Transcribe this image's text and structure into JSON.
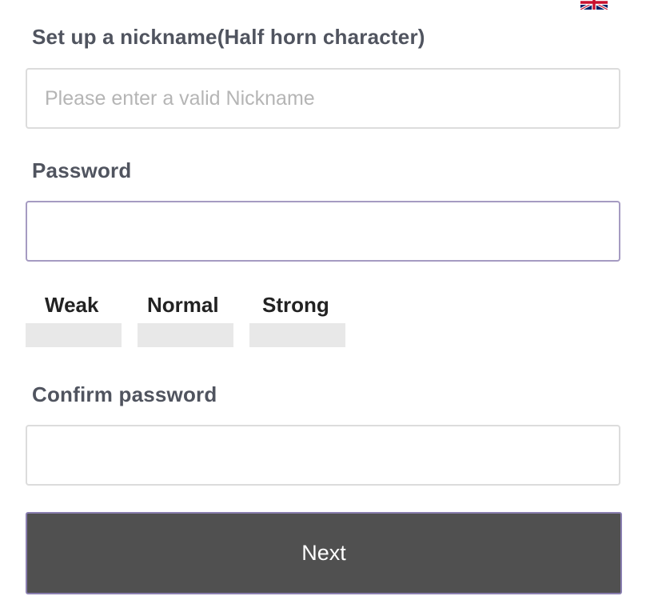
{
  "language_flag": {
    "icon": "uk-flag-icon"
  },
  "nickname": {
    "label": "Set up a nickname(Half horn character)",
    "placeholder": "Please enter a valid Nickname",
    "value": ""
  },
  "password": {
    "label": "Password",
    "value": ""
  },
  "strength": {
    "weak": "Weak",
    "normal": "Normal",
    "strong": "Strong",
    "level": 0
  },
  "confirm_password": {
    "label": "Confirm password",
    "value": ""
  },
  "next_button": {
    "label": "Next"
  },
  "colors": {
    "button_bg": "#505050",
    "focus_border": "#a59bc2",
    "strength_inactive": "#e8e8e8"
  }
}
